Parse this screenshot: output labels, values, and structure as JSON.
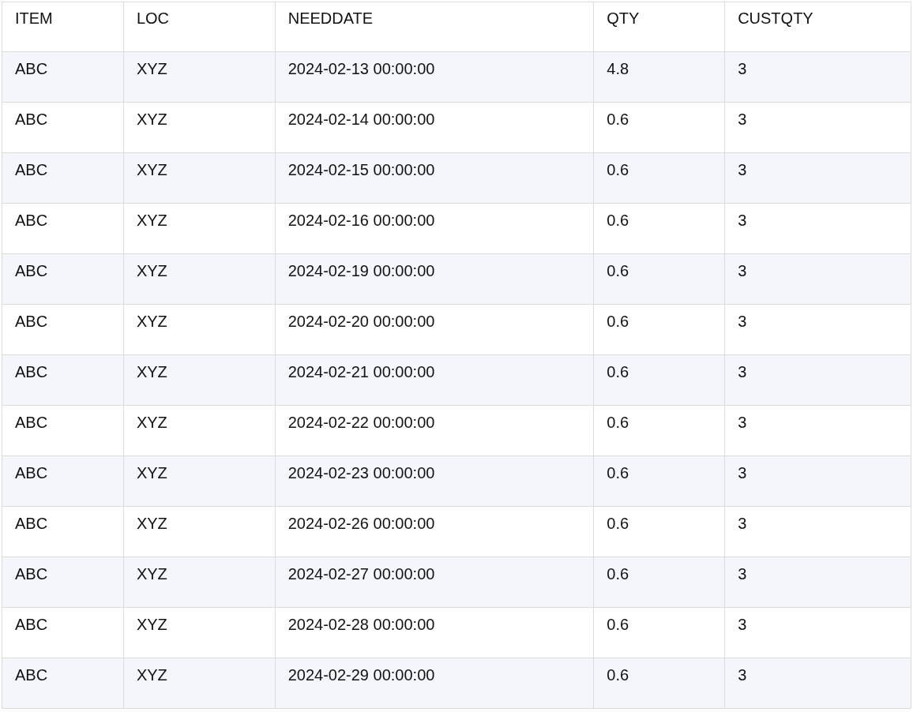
{
  "table": {
    "columns": [
      "ITEM",
      "LOC",
      "NEEDDATE",
      "QTY",
      "CUSTQTY"
    ],
    "rows": [
      [
        "ABC",
        "XYZ",
        "2024-02-13 00:00:00",
        "4.8",
        "3"
      ],
      [
        "ABC",
        "XYZ",
        "2024-02-14 00:00:00",
        "0.6",
        "3"
      ],
      [
        "ABC",
        "XYZ",
        "2024-02-15 00:00:00",
        "0.6",
        "3"
      ],
      [
        "ABC",
        "XYZ",
        "2024-02-16 00:00:00",
        "0.6",
        "3"
      ],
      [
        "ABC",
        "XYZ",
        "2024-02-19 00:00:00",
        "0.6",
        "3"
      ],
      [
        "ABC",
        "XYZ",
        "2024-02-20 00:00:00",
        "0.6",
        "3"
      ],
      [
        "ABC",
        "XYZ",
        "2024-02-21 00:00:00",
        "0.6",
        "3"
      ],
      [
        "ABC",
        "XYZ",
        "2024-02-22 00:00:00",
        "0.6",
        "3"
      ],
      [
        "ABC",
        "XYZ",
        "2024-02-23 00:00:00",
        "0.6",
        "3"
      ],
      [
        "ABC",
        "XYZ",
        "2024-02-26 00:00:00",
        "0.6",
        "3"
      ],
      [
        "ABC",
        "XYZ",
        "2024-02-27 00:00:00",
        "0.6",
        "3"
      ],
      [
        "ABC",
        "XYZ",
        "2024-02-28 00:00:00",
        "0.6",
        "3"
      ],
      [
        "ABC",
        "XYZ",
        "2024-02-29 00:00:00",
        "0.6",
        "3"
      ]
    ]
  }
}
